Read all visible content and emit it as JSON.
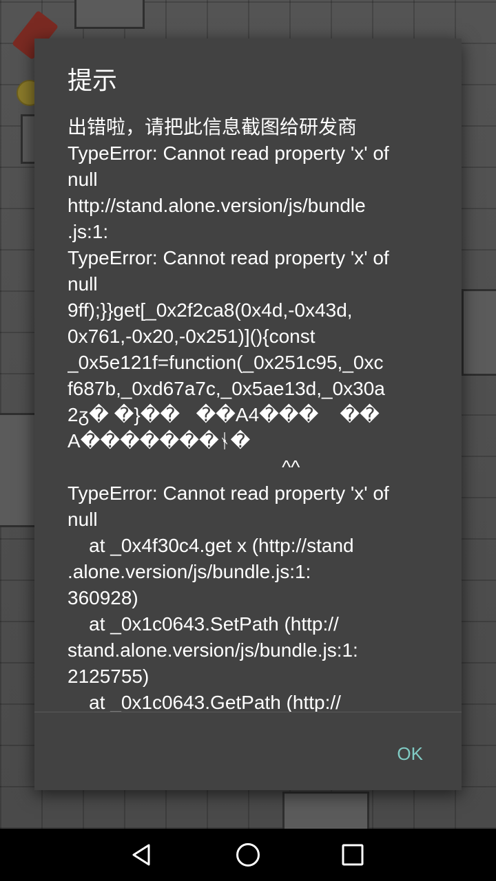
{
  "dialog": {
    "title": "提示",
    "message_lines": [
      "出错啦，请把此信息截图给研发商",
      "TypeError: Cannot read property 'x' of",
      "null",
      "http://stand.alone.version/js/bundle",
      ".js:1:",
      "TypeError: Cannot read property 'x' of",
      "null",
      "9ff);}}get[_0x2f2ca8(0x4d,-0x43d,",
      "0x761,-0x20,-0x251)](){const",
      "_0x5e121f=function(_0x251c95,_0xc",
      "f687b,_0xd67a7c,_0x5ae13d,_0x30a",
      "2ᵹ� �}��   ��A4���    ��",
      "A�������ᛀ�",
      "                                        ^^",
      "TypeError: Cannot read property 'x' of",
      "null",
      "    at _0x4f30c4.get x (http://stand",
      ".alone.version/js/bundle.js:1:",
      "360928)",
      "    at _0x1c0643.SetPath (http://",
      "stand.alone.version/js/bundle.js:1:",
      "2125755)",
      "    at _0x1c0643.GetPath (http://"
    ],
    "ok_label": "OK",
    "accent_color": "#80cbc4"
  },
  "navbar": {
    "back_icon": "back-triangle-icon",
    "home_icon": "home-circle-icon",
    "recents_icon": "recents-square-icon"
  }
}
